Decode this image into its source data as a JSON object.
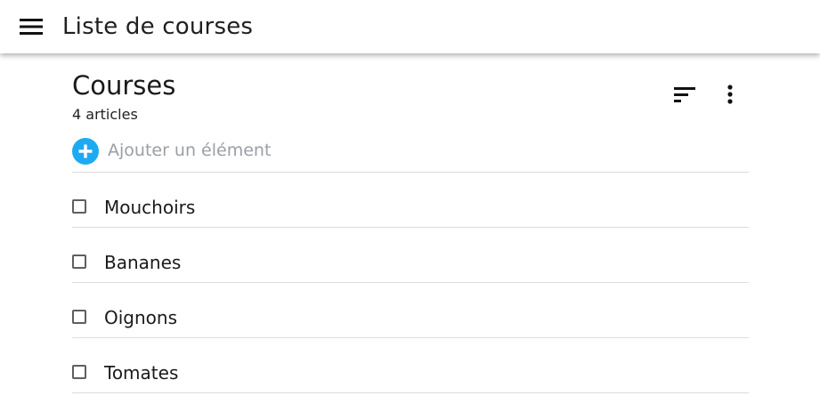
{
  "app": {
    "title": "Liste de courses",
    "menu_icon": "menu-icon"
  },
  "list": {
    "title": "Courses",
    "count": "4 articles",
    "sort_icon": "sort-icon",
    "more_icon": "more-vert-icon"
  },
  "add_item": {
    "placeholder": "Ajouter un élément",
    "icon": "add-circle-icon",
    "accent_color": "#1eaaf1"
  },
  "items": [
    {
      "label": "Mouchoirs",
      "checked": false
    },
    {
      "label": "Bananes",
      "checked": false
    },
    {
      "label": "Oignons",
      "checked": false
    },
    {
      "label": "Tomates",
      "checked": false
    }
  ]
}
